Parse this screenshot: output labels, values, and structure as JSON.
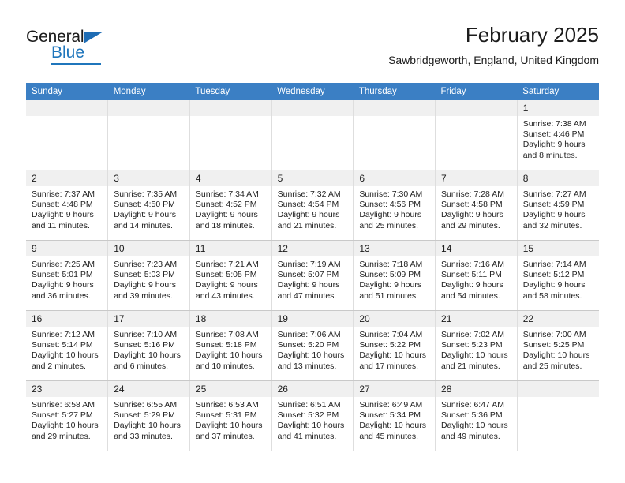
{
  "brand": {
    "name_part1": "General",
    "name_part2": "Blue",
    "triangle_color": "#1f6db5",
    "blue_color": "#1f76bc"
  },
  "header": {
    "title": "February 2025",
    "location": "Sawbridgeworth, England, United Kingdom"
  },
  "theme": {
    "header_row_bg": "#3b7fc4",
    "daynum_bg": "#f0f0f0",
    "grid_line": "#c9c9c9"
  },
  "weekdays": [
    "Sunday",
    "Monday",
    "Tuesday",
    "Wednesday",
    "Thursday",
    "Friday",
    "Saturday"
  ],
  "weeks": [
    [
      {
        "day": "",
        "sunrise": "",
        "sunset": "",
        "daylight1": "",
        "daylight2": "",
        "blank": true
      },
      {
        "day": "",
        "sunrise": "",
        "sunset": "",
        "daylight1": "",
        "daylight2": "",
        "blank": true
      },
      {
        "day": "",
        "sunrise": "",
        "sunset": "",
        "daylight1": "",
        "daylight2": "",
        "blank": true
      },
      {
        "day": "",
        "sunrise": "",
        "sunset": "",
        "daylight1": "",
        "daylight2": "",
        "blank": true
      },
      {
        "day": "",
        "sunrise": "",
        "sunset": "",
        "daylight1": "",
        "daylight2": "",
        "blank": true
      },
      {
        "day": "",
        "sunrise": "",
        "sunset": "",
        "daylight1": "",
        "daylight2": "",
        "blank": true
      },
      {
        "day": "1",
        "sunrise": "Sunrise: 7:38 AM",
        "sunset": "Sunset: 4:46 PM",
        "daylight1": "Daylight: 9 hours",
        "daylight2": "and 8 minutes.",
        "blank": false
      }
    ],
    [
      {
        "day": "2",
        "sunrise": "Sunrise: 7:37 AM",
        "sunset": "Sunset: 4:48 PM",
        "daylight1": "Daylight: 9 hours",
        "daylight2": "and 11 minutes.",
        "blank": false
      },
      {
        "day": "3",
        "sunrise": "Sunrise: 7:35 AM",
        "sunset": "Sunset: 4:50 PM",
        "daylight1": "Daylight: 9 hours",
        "daylight2": "and 14 minutes.",
        "blank": false
      },
      {
        "day": "4",
        "sunrise": "Sunrise: 7:34 AM",
        "sunset": "Sunset: 4:52 PM",
        "daylight1": "Daylight: 9 hours",
        "daylight2": "and 18 minutes.",
        "blank": false
      },
      {
        "day": "5",
        "sunrise": "Sunrise: 7:32 AM",
        "sunset": "Sunset: 4:54 PM",
        "daylight1": "Daylight: 9 hours",
        "daylight2": "and 21 minutes.",
        "blank": false
      },
      {
        "day": "6",
        "sunrise": "Sunrise: 7:30 AM",
        "sunset": "Sunset: 4:56 PM",
        "daylight1": "Daylight: 9 hours",
        "daylight2": "and 25 minutes.",
        "blank": false
      },
      {
        "day": "7",
        "sunrise": "Sunrise: 7:28 AM",
        "sunset": "Sunset: 4:58 PM",
        "daylight1": "Daylight: 9 hours",
        "daylight2": "and 29 minutes.",
        "blank": false
      },
      {
        "day": "8",
        "sunrise": "Sunrise: 7:27 AM",
        "sunset": "Sunset: 4:59 PM",
        "daylight1": "Daylight: 9 hours",
        "daylight2": "and 32 minutes.",
        "blank": false
      }
    ],
    [
      {
        "day": "9",
        "sunrise": "Sunrise: 7:25 AM",
        "sunset": "Sunset: 5:01 PM",
        "daylight1": "Daylight: 9 hours",
        "daylight2": "and 36 minutes.",
        "blank": false
      },
      {
        "day": "10",
        "sunrise": "Sunrise: 7:23 AM",
        "sunset": "Sunset: 5:03 PM",
        "daylight1": "Daylight: 9 hours",
        "daylight2": "and 39 minutes.",
        "blank": false
      },
      {
        "day": "11",
        "sunrise": "Sunrise: 7:21 AM",
        "sunset": "Sunset: 5:05 PM",
        "daylight1": "Daylight: 9 hours",
        "daylight2": "and 43 minutes.",
        "blank": false
      },
      {
        "day": "12",
        "sunrise": "Sunrise: 7:19 AM",
        "sunset": "Sunset: 5:07 PM",
        "daylight1": "Daylight: 9 hours",
        "daylight2": "and 47 minutes.",
        "blank": false
      },
      {
        "day": "13",
        "sunrise": "Sunrise: 7:18 AM",
        "sunset": "Sunset: 5:09 PM",
        "daylight1": "Daylight: 9 hours",
        "daylight2": "and 51 minutes.",
        "blank": false
      },
      {
        "day": "14",
        "sunrise": "Sunrise: 7:16 AM",
        "sunset": "Sunset: 5:11 PM",
        "daylight1": "Daylight: 9 hours",
        "daylight2": "and 54 minutes.",
        "blank": false
      },
      {
        "day": "15",
        "sunrise": "Sunrise: 7:14 AM",
        "sunset": "Sunset: 5:12 PM",
        "daylight1": "Daylight: 9 hours",
        "daylight2": "and 58 minutes.",
        "blank": false
      }
    ],
    [
      {
        "day": "16",
        "sunrise": "Sunrise: 7:12 AM",
        "sunset": "Sunset: 5:14 PM",
        "daylight1": "Daylight: 10 hours",
        "daylight2": "and 2 minutes.",
        "blank": false
      },
      {
        "day": "17",
        "sunrise": "Sunrise: 7:10 AM",
        "sunset": "Sunset: 5:16 PM",
        "daylight1": "Daylight: 10 hours",
        "daylight2": "and 6 minutes.",
        "blank": false
      },
      {
        "day": "18",
        "sunrise": "Sunrise: 7:08 AM",
        "sunset": "Sunset: 5:18 PM",
        "daylight1": "Daylight: 10 hours",
        "daylight2": "and 10 minutes.",
        "blank": false
      },
      {
        "day": "19",
        "sunrise": "Sunrise: 7:06 AM",
        "sunset": "Sunset: 5:20 PM",
        "daylight1": "Daylight: 10 hours",
        "daylight2": "and 13 minutes.",
        "blank": false
      },
      {
        "day": "20",
        "sunrise": "Sunrise: 7:04 AM",
        "sunset": "Sunset: 5:22 PM",
        "daylight1": "Daylight: 10 hours",
        "daylight2": "and 17 minutes.",
        "blank": false
      },
      {
        "day": "21",
        "sunrise": "Sunrise: 7:02 AM",
        "sunset": "Sunset: 5:23 PM",
        "daylight1": "Daylight: 10 hours",
        "daylight2": "and 21 minutes.",
        "blank": false
      },
      {
        "day": "22",
        "sunrise": "Sunrise: 7:00 AM",
        "sunset": "Sunset: 5:25 PM",
        "daylight1": "Daylight: 10 hours",
        "daylight2": "and 25 minutes.",
        "blank": false
      }
    ],
    [
      {
        "day": "23",
        "sunrise": "Sunrise: 6:58 AM",
        "sunset": "Sunset: 5:27 PM",
        "daylight1": "Daylight: 10 hours",
        "daylight2": "and 29 minutes.",
        "blank": false
      },
      {
        "day": "24",
        "sunrise": "Sunrise: 6:55 AM",
        "sunset": "Sunset: 5:29 PM",
        "daylight1": "Daylight: 10 hours",
        "daylight2": "and 33 minutes.",
        "blank": false
      },
      {
        "day": "25",
        "sunrise": "Sunrise: 6:53 AM",
        "sunset": "Sunset: 5:31 PM",
        "daylight1": "Daylight: 10 hours",
        "daylight2": "and 37 minutes.",
        "blank": false
      },
      {
        "day": "26",
        "sunrise": "Sunrise: 6:51 AM",
        "sunset": "Sunset: 5:32 PM",
        "daylight1": "Daylight: 10 hours",
        "daylight2": "and 41 minutes.",
        "blank": false
      },
      {
        "day": "27",
        "sunrise": "Sunrise: 6:49 AM",
        "sunset": "Sunset: 5:34 PM",
        "daylight1": "Daylight: 10 hours",
        "daylight2": "and 45 minutes.",
        "blank": false
      },
      {
        "day": "28",
        "sunrise": "Sunrise: 6:47 AM",
        "sunset": "Sunset: 5:36 PM",
        "daylight1": "Daylight: 10 hours",
        "daylight2": "and 49 minutes.",
        "blank": false
      },
      {
        "day": "",
        "sunrise": "",
        "sunset": "",
        "daylight1": "",
        "daylight2": "",
        "blank": true
      }
    ]
  ]
}
